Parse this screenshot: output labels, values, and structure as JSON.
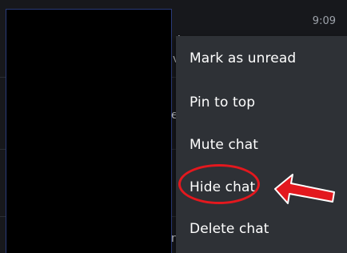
{
  "status": {
    "time": "9:09"
  },
  "background_fragments": {
    "frag1": "t",
    "frag2": "v",
    "frag3": "e",
    "frag4": "n"
  },
  "context_menu": {
    "items": [
      {
        "label": "Mark as unread"
      },
      {
        "label": "Pin to top"
      },
      {
        "label": "Mute chat"
      },
      {
        "label": "Hide chat"
      },
      {
        "label": "Delete chat"
      }
    ]
  },
  "annotation": {
    "highlight_color": "#e3181e",
    "highlighted_item": "Hide chat",
    "arrow_icon": "red-arrow-left-icon"
  }
}
